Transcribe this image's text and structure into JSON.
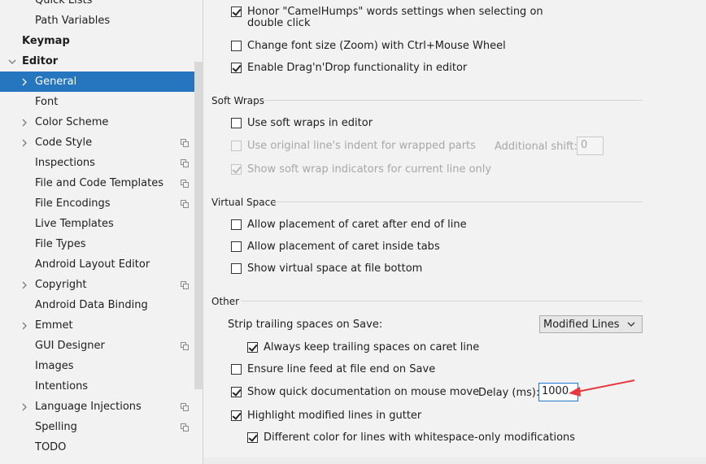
{
  "sidebar": {
    "items": [
      {
        "label": "Quick Lists",
        "level": 1,
        "chevron": false,
        "copy": false
      },
      {
        "label": "Path Variables",
        "level": 1,
        "chevron": false,
        "copy": false
      },
      {
        "label": "Keymap",
        "level": 0,
        "chevron": false,
        "copy": false,
        "bold": true
      },
      {
        "label": "Editor",
        "level": 0,
        "chevron": "down",
        "copy": false,
        "bold": true
      },
      {
        "label": "General",
        "level": 1,
        "chevron": "right",
        "copy": false,
        "selected": true
      },
      {
        "label": "Font",
        "level": 1,
        "chevron": false,
        "copy": false
      },
      {
        "label": "Color Scheme",
        "level": 1,
        "chevron": "right",
        "copy": false
      },
      {
        "label": "Code Style",
        "level": 1,
        "chevron": "right",
        "copy": true
      },
      {
        "label": "Inspections",
        "level": 1,
        "chevron": false,
        "copy": true
      },
      {
        "label": "File and Code Templates",
        "level": 1,
        "chevron": false,
        "copy": true
      },
      {
        "label": "File Encodings",
        "level": 1,
        "chevron": false,
        "copy": true
      },
      {
        "label": "Live Templates",
        "level": 1,
        "chevron": false,
        "copy": false
      },
      {
        "label": "File Types",
        "level": 1,
        "chevron": false,
        "copy": false
      },
      {
        "label": "Android Layout Editor",
        "level": 1,
        "chevron": false,
        "copy": false
      },
      {
        "label": "Copyright",
        "level": 1,
        "chevron": "right",
        "copy": true
      },
      {
        "label": "Android Data Binding",
        "level": 1,
        "chevron": false,
        "copy": false
      },
      {
        "label": "Emmet",
        "level": 1,
        "chevron": "right",
        "copy": false
      },
      {
        "label": "GUI Designer",
        "level": 1,
        "chevron": false,
        "copy": true
      },
      {
        "label": "Images",
        "level": 1,
        "chevron": false,
        "copy": false
      },
      {
        "label": "Intentions",
        "level": 1,
        "chevron": false,
        "copy": false
      },
      {
        "label": "Language Injections",
        "level": 1,
        "chevron": "right",
        "copy": true
      },
      {
        "label": "Spelling",
        "level": 1,
        "chevron": false,
        "copy": true
      },
      {
        "label": "TODO",
        "level": 1,
        "chevron": false,
        "copy": false
      }
    ]
  },
  "main": {
    "top": {
      "camelhumps_line1": "Honor \"CamelHumps\" words settings when selecting on",
      "camelhumps_line2": "double click",
      "zoom": "Change font size (Zoom) with Ctrl+Mouse Wheel",
      "dragdrop": "Enable Drag'n'Drop functionality in editor"
    },
    "soft_wraps": {
      "title": "Soft Wraps",
      "use_soft_wraps": "Use soft wraps in editor",
      "original_indent": "Use original line's indent for wrapped parts",
      "additional_shift_label": "Additional shift:",
      "additional_shift_value": "0",
      "show_indicators": "Show soft wrap indicators for current line only"
    },
    "virtual_space": {
      "title": "Virtual Space",
      "after_end": "Allow placement of caret after end of line",
      "inside_tabs": "Allow placement of caret inside tabs",
      "file_bottom": "Show virtual space at file bottom"
    },
    "other": {
      "title": "Other",
      "strip_label": "Strip trailing spaces on Save:",
      "strip_value": "Modified Lines",
      "keep_trailing": "Always keep trailing spaces on caret line",
      "line_feed": "Ensure line feed at file end on Save",
      "quick_doc": "Show quick documentation on mouse move",
      "delay_label": "Delay (ms):",
      "delay_value": "1000",
      "highlight_modified": "Highlight modified lines in gutter",
      "different_color": "Different color for lines with whitespace-only modifications"
    }
  },
  "colors": {
    "selection": "#2675bf",
    "annotation_arrow": "#e8383d",
    "focus_border": "#1f78d1"
  }
}
